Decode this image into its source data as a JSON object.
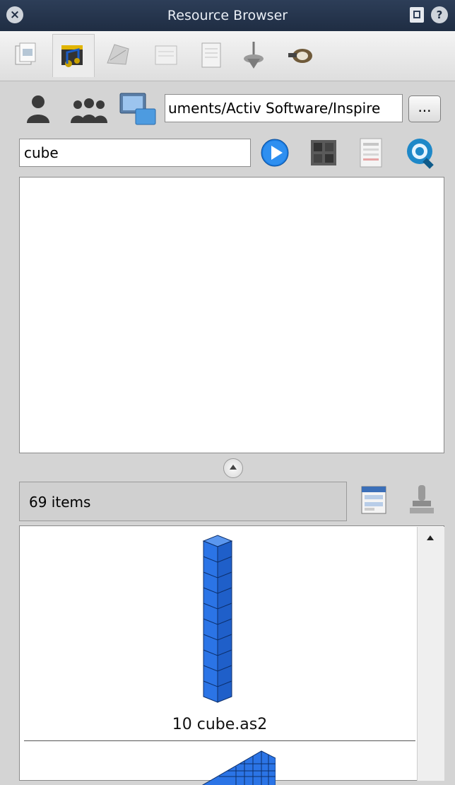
{
  "window": {
    "title": "Resource Browser"
  },
  "icons": {
    "close": "close-icon",
    "pin": "pin-icon",
    "help": "help-icon",
    "tabs": [
      "my-resources-tab-icon",
      "media-tab-icon",
      "shapes-tab-icon",
      "notes-tab-icon",
      "pages-tab-icon",
      "lesson-tab-icon",
      "tools-tab-icon"
    ]
  },
  "location": {
    "path": "uments/Activ Software/Inspire",
    "browse_label": "..."
  },
  "search": {
    "query": "cube"
  },
  "status": {
    "count_label": "69 items"
  },
  "items": [
    {
      "label": "10 cube.as2"
    },
    {
      "label": ""
    }
  ],
  "colors": {
    "titlebar": "#24334c",
    "accent": "#1a7be0",
    "cube": "#2b74e6"
  }
}
